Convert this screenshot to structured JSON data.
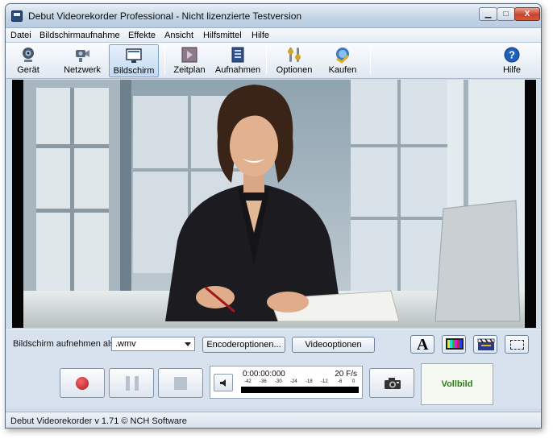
{
  "window": {
    "title": "Debut Videorekorder Professional - Nicht lizenzierte Testversion",
    "minimize_symbol": "▁",
    "maximize_symbol": "□",
    "close_symbol": "X"
  },
  "menu": {
    "items": [
      "Datei",
      "Bildschirmaufnahme",
      "Effekte",
      "Ansicht",
      "Hilfsmittel",
      "Hilfe"
    ]
  },
  "toolbar": {
    "items": [
      {
        "label": "Gerät",
        "icon": "webcam-icon"
      },
      {
        "label": "Netzwerk",
        "icon": "network-camera-icon"
      },
      {
        "label": "Bildschirm",
        "icon": "screen-icon",
        "active": true
      },
      {
        "label": "Zeitplan",
        "icon": "schedule-icon"
      },
      {
        "label": "Aufnahmen",
        "icon": "recordings-icon"
      },
      {
        "label": "Optionen",
        "icon": "options-icon"
      },
      {
        "label": "Kaufen",
        "icon": "buy-icon"
      },
      {
        "label": "Hilfe",
        "icon": "help-icon"
      }
    ]
  },
  "options": {
    "record_as_label": "Bildschirm aufnehmen als:",
    "format_value": ".wmv",
    "encoder_button": "Encoderoptionen...",
    "video_button": "Videooptionen",
    "text_overlay_glyph": "A"
  },
  "controls": {
    "timecode": "0:00:00:000",
    "fps": "20 F/s",
    "meter_scale": [
      "-42",
      "-36",
      "-30",
      "-24",
      "-18",
      "-12",
      "-6",
      "0"
    ],
    "level_fraction": 0,
    "fullscreen_label": "Vollbild"
  },
  "status": {
    "text": "Debut Videorekorder v 1.71 © NCH Software"
  },
  "colors": {
    "record_red": "#c2181d",
    "fullscreen_green": "#2c7b16",
    "window_blue": "#cfdcea"
  }
}
